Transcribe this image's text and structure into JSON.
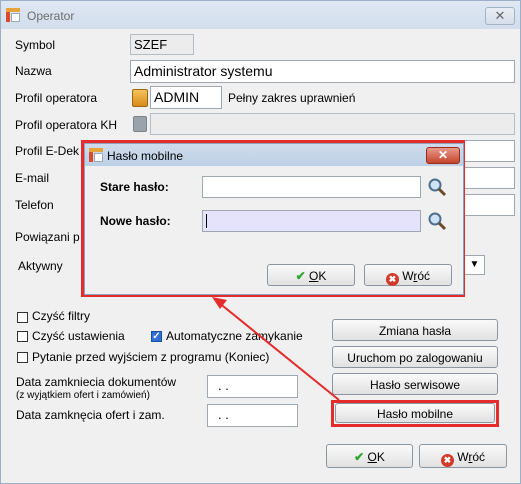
{
  "window": {
    "title": "Operator",
    "close": "✕"
  },
  "form": {
    "symbol_label": "Symbol",
    "symbol_value": "SZEF",
    "nazwa_label": "Nazwa",
    "nazwa_value": "Administrator systemu",
    "profil_label": "Profil operatora",
    "profil_value": "ADMIN",
    "profil_desc": "Pełny zakres uprawnień",
    "profil_kh_label": "Profil operatora KH",
    "profil_kh_value": "",
    "profil_edek_label": "Profil E-Dek",
    "email_label": "E-mail",
    "telefon_label": "Telefon",
    "powiazani_label": "Powiązani p",
    "aktywny_label": "Aktywny"
  },
  "checkboxes": {
    "czysc_filtry": {
      "label": "Czyść filtry",
      "checked": false
    },
    "czysc_ustawienia": {
      "label": "Czyść ustawienia",
      "checked": false
    },
    "automatyczne": {
      "label": "Automatyczne zamykanie",
      "checked": true
    },
    "pytanie": {
      "label": "Pytanie przed wyjściem z programu (Koniec)",
      "checked": false
    }
  },
  "dates": {
    "docs_label": "Data zamkniecia dokumentów",
    "docs_sublabel": "(z wyjątkiem ofert i zamówień)",
    "docs_value": ". .",
    "offers_label": "Data zamknęcia ofert i zam.",
    "offers_value": ". ."
  },
  "side_buttons": {
    "zmiana": "Zmiana hasła",
    "uruchom": "Uruchom po zalogowaniu",
    "serwisowe": "Hasło serwisowe",
    "mobilne": "Hasło mobilne"
  },
  "main_buttons": {
    "ok_u": "O",
    "ok_rest": "K",
    "cancel_pre": "W",
    "cancel_u": "r",
    "cancel_post": "óć"
  },
  "dialog": {
    "title": "Hasło mobilne",
    "close": "✕",
    "old_label": "Stare hasło:",
    "old_value": "",
    "new_label": "Nowe hasło:",
    "new_value": "",
    "ok_u": "O",
    "ok_rest": "K",
    "cancel_pre": "W",
    "cancel_u": "r",
    "cancel_post": "óć"
  },
  "colors": {
    "highlight": "#e52b2b",
    "check_accent": "#2ea52e",
    "cancel_accent": "#d23a2a"
  }
}
